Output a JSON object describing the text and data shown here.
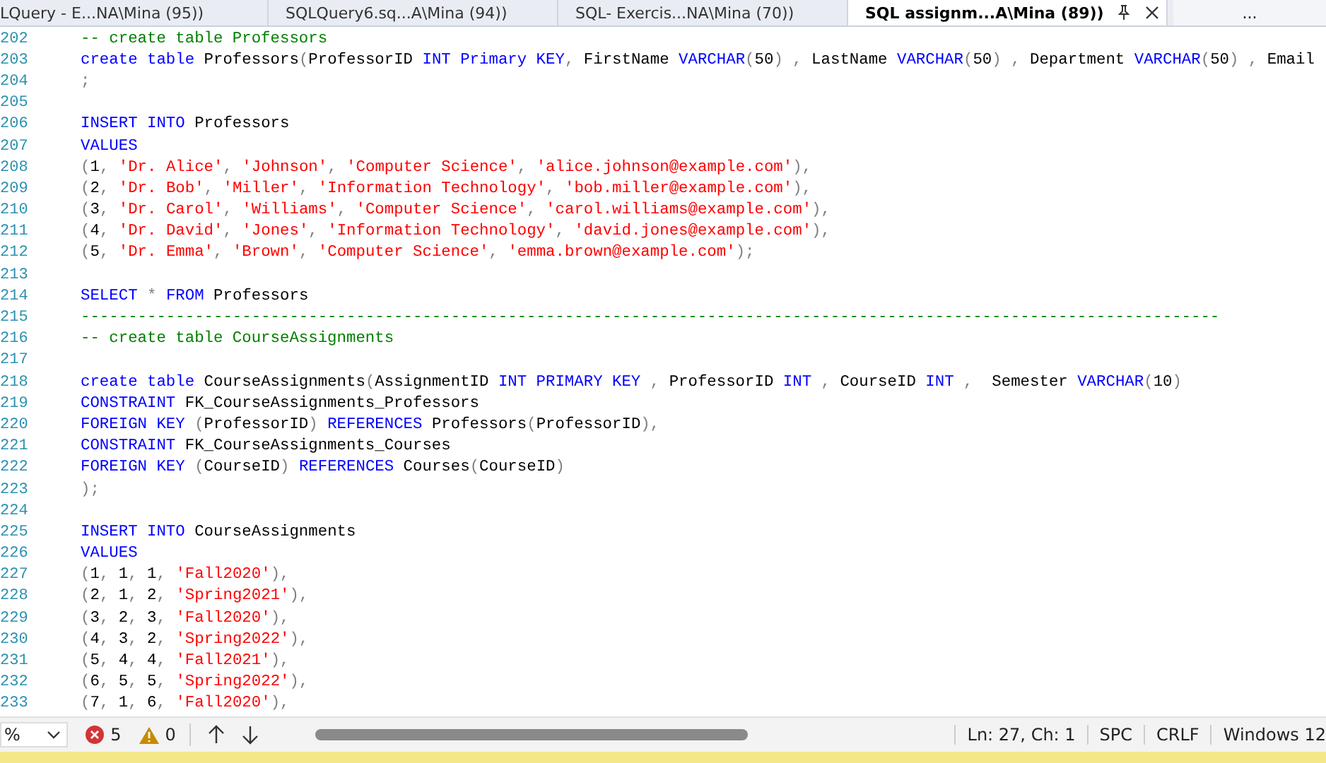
{
  "tabs": [
    {
      "label": "LQuery - E...NA\\Mina (95))",
      "selected": false
    },
    {
      "label": "SQLQuery6.sq...A\\Mina (94))",
      "selected": false
    },
    {
      "label": "SQL- Exercis...NA\\Mina (70))",
      "selected": false
    },
    {
      "label": "SQL assignm...A\\Mina (89))",
      "selected": true
    }
  ],
  "overflow_button": "...",
  "editor": {
    "lines": [
      {
        "number": "202",
        "tokens": [
          {
            "kind": "cmt",
            "text": "-- create table Professors"
          }
        ]
      },
      {
        "number": "203",
        "tokens": [
          {
            "kind": "kw",
            "text": "create table"
          },
          {
            "kind": "txt",
            "text": " Professors"
          },
          {
            "kind": "op",
            "text": "("
          },
          {
            "kind": "txt",
            "text": "ProfessorID "
          },
          {
            "kind": "kw",
            "text": "INT Primary KEY"
          },
          {
            "kind": "op",
            "text": ","
          },
          {
            "kind": "txt",
            "text": " FirstName "
          },
          {
            "kind": "kw",
            "text": "VARCHAR"
          },
          {
            "kind": "op",
            "text": "("
          },
          {
            "kind": "txt",
            "text": "50"
          },
          {
            "kind": "op",
            "text": ") , "
          },
          {
            "kind": "txt",
            "text": "LastName "
          },
          {
            "kind": "kw",
            "text": "VARCHAR"
          },
          {
            "kind": "op",
            "text": "("
          },
          {
            "kind": "txt",
            "text": "50"
          },
          {
            "kind": "op",
            "text": ") , "
          },
          {
            "kind": "txt",
            "text": "Department "
          },
          {
            "kind": "kw",
            "text": "VARCHAR"
          },
          {
            "kind": "op",
            "text": "("
          },
          {
            "kind": "txt",
            "text": "50"
          },
          {
            "kind": "op",
            "text": ") , "
          },
          {
            "kind": "txt",
            "text": "Email"
          }
        ]
      },
      {
        "number": "204",
        "tokens": [
          {
            "kind": "op",
            "text": ";"
          }
        ]
      },
      {
        "number": "205"
      },
      {
        "number": "206",
        "tokens": [
          {
            "kind": "kw",
            "text": "INSERT INTO"
          },
          {
            "kind": "txt",
            "text": " Professors"
          }
        ]
      },
      {
        "number": "207",
        "tokens": [
          {
            "kind": "kw",
            "text": "VALUES"
          }
        ]
      },
      {
        "number": "208",
        "tokens": [
          {
            "kind": "op",
            "text": "("
          },
          {
            "kind": "txt",
            "text": "1"
          },
          {
            "kind": "op",
            "text": ", "
          },
          {
            "kind": "str",
            "text": "'Dr. Alice'"
          },
          {
            "kind": "op",
            "text": ", "
          },
          {
            "kind": "str",
            "text": "'Johnson'"
          },
          {
            "kind": "op",
            "text": ", "
          },
          {
            "kind": "str",
            "text": "'Computer Science'"
          },
          {
            "kind": "op",
            "text": ", "
          },
          {
            "kind": "str",
            "text": "'alice.johnson@example.com'"
          },
          {
            "kind": "op",
            "text": "),"
          }
        ]
      },
      {
        "number": "209",
        "tokens": [
          {
            "kind": "op",
            "text": "("
          },
          {
            "kind": "txt",
            "text": "2"
          },
          {
            "kind": "op",
            "text": ", "
          },
          {
            "kind": "str",
            "text": "'Dr. Bob'"
          },
          {
            "kind": "op",
            "text": ", "
          },
          {
            "kind": "str",
            "text": "'Miller'"
          },
          {
            "kind": "op",
            "text": ", "
          },
          {
            "kind": "str",
            "text": "'Information Technology'"
          },
          {
            "kind": "op",
            "text": ", "
          },
          {
            "kind": "str",
            "text": "'bob.miller@example.com'"
          },
          {
            "kind": "op",
            "text": "),"
          }
        ]
      },
      {
        "number": "210",
        "tokens": [
          {
            "kind": "op",
            "text": "("
          },
          {
            "kind": "txt",
            "text": "3"
          },
          {
            "kind": "op",
            "text": ", "
          },
          {
            "kind": "str",
            "text": "'Dr. Carol'"
          },
          {
            "kind": "op",
            "text": ", "
          },
          {
            "kind": "str",
            "text": "'Williams'"
          },
          {
            "kind": "op",
            "text": ", "
          },
          {
            "kind": "str",
            "text": "'Computer Science'"
          },
          {
            "kind": "op",
            "text": ", "
          },
          {
            "kind": "str",
            "text": "'carol.williams@example.com'"
          },
          {
            "kind": "op",
            "text": "),"
          }
        ]
      },
      {
        "number": "211",
        "tokens": [
          {
            "kind": "op",
            "text": "("
          },
          {
            "kind": "txt",
            "text": "4"
          },
          {
            "kind": "op",
            "text": ", "
          },
          {
            "kind": "str",
            "text": "'Dr. David'"
          },
          {
            "kind": "op",
            "text": ", "
          },
          {
            "kind": "str",
            "text": "'Jones'"
          },
          {
            "kind": "op",
            "text": ", "
          },
          {
            "kind": "str",
            "text": "'Information Technology'"
          },
          {
            "kind": "op",
            "text": ", "
          },
          {
            "kind": "str",
            "text": "'david.jones@example.com'"
          },
          {
            "kind": "op",
            "text": "),"
          }
        ]
      },
      {
        "number": "212",
        "tokens": [
          {
            "kind": "op",
            "text": "("
          },
          {
            "kind": "txt",
            "text": "5"
          },
          {
            "kind": "op",
            "text": ", "
          },
          {
            "kind": "str",
            "text": "'Dr. Emma'"
          },
          {
            "kind": "op",
            "text": ", "
          },
          {
            "kind": "str",
            "text": "'Brown'"
          },
          {
            "kind": "op",
            "text": ", "
          },
          {
            "kind": "str",
            "text": "'Computer Science'"
          },
          {
            "kind": "op",
            "text": ", "
          },
          {
            "kind": "str",
            "text": "'emma.brown@example.com'"
          },
          {
            "kind": "op",
            "text": ");"
          }
        ]
      },
      {
        "number": "213"
      },
      {
        "number": "214",
        "tokens": [
          {
            "kind": "kw",
            "text": "SELECT"
          },
          {
            "kind": "op",
            "text": " * "
          },
          {
            "kind": "kw",
            "text": "FROM"
          },
          {
            "kind": "txt",
            "text": " Professors"
          }
        ]
      },
      {
        "number": "215",
        "tokens": [
          {
            "kind": "cmt",
            "text": "------------------------------------------------------------------------------------------------------------------------"
          }
        ]
      },
      {
        "number": "216",
        "tokens": [
          {
            "kind": "cmt",
            "text": "-- create table CourseAssignments"
          }
        ]
      },
      {
        "number": "217"
      },
      {
        "number": "218",
        "tokens": [
          {
            "kind": "kw",
            "text": "create table"
          },
          {
            "kind": "txt",
            "text": " CourseAssignments"
          },
          {
            "kind": "op",
            "text": "("
          },
          {
            "kind": "txt",
            "text": "AssignmentID "
          },
          {
            "kind": "kw",
            "text": "INT PRIMARY KEY"
          },
          {
            "kind": "op",
            "text": " , "
          },
          {
            "kind": "txt",
            "text": "ProfessorID "
          },
          {
            "kind": "kw",
            "text": "INT"
          },
          {
            "kind": "op",
            "text": " , "
          },
          {
            "kind": "txt",
            "text": "CourseID "
          },
          {
            "kind": "kw",
            "text": "INT"
          },
          {
            "kind": "op",
            "text": " ,  "
          },
          {
            "kind": "txt",
            "text": "Semester "
          },
          {
            "kind": "kw",
            "text": "VARCHAR"
          },
          {
            "kind": "op",
            "text": "("
          },
          {
            "kind": "txt",
            "text": "10"
          },
          {
            "kind": "op",
            "text": ")"
          }
        ]
      },
      {
        "number": "219",
        "tokens": [
          {
            "kind": "kw",
            "text": "CONSTRAINT"
          },
          {
            "kind": "txt",
            "text": " FK_CourseAssignments_Professors"
          }
        ]
      },
      {
        "number": "220",
        "tokens": [
          {
            "kind": "kw",
            "text": "FOREIGN KEY"
          },
          {
            "kind": "op",
            "text": " ("
          },
          {
            "kind": "txt",
            "text": "ProfessorID"
          },
          {
            "kind": "op",
            "text": ") "
          },
          {
            "kind": "kw",
            "text": "REFERENCES"
          },
          {
            "kind": "txt",
            "text": " Professors"
          },
          {
            "kind": "op",
            "text": "("
          },
          {
            "kind": "txt",
            "text": "ProfessorID"
          },
          {
            "kind": "op",
            "text": "),"
          }
        ]
      },
      {
        "number": "221",
        "tokens": [
          {
            "kind": "kw",
            "text": "CONSTRAINT"
          },
          {
            "kind": "txt",
            "text": " FK_CourseAssignments_Courses"
          }
        ]
      },
      {
        "number": "222",
        "tokens": [
          {
            "kind": "kw",
            "text": "FOREIGN KEY"
          },
          {
            "kind": "op",
            "text": " ("
          },
          {
            "kind": "txt",
            "text": "CourseID"
          },
          {
            "kind": "op",
            "text": ") "
          },
          {
            "kind": "kw",
            "text": "REFERENCES"
          },
          {
            "kind": "txt",
            "text": " Courses"
          },
          {
            "kind": "op",
            "text": "("
          },
          {
            "kind": "txt",
            "text": "CourseID"
          },
          {
            "kind": "op",
            "text": ")"
          }
        ]
      },
      {
        "number": "223",
        "tokens": [
          {
            "kind": "op",
            "text": ");"
          }
        ]
      },
      {
        "number": "224"
      },
      {
        "number": "225",
        "tokens": [
          {
            "kind": "kw",
            "text": "INSERT INTO"
          },
          {
            "kind": "txt",
            "text": " CourseAssignments"
          }
        ]
      },
      {
        "number": "226",
        "tokens": [
          {
            "kind": "kw",
            "text": "VALUES"
          }
        ]
      },
      {
        "number": "227",
        "tokens": [
          {
            "kind": "op",
            "text": "("
          },
          {
            "kind": "txt",
            "text": "1"
          },
          {
            "kind": "op",
            "text": ", "
          },
          {
            "kind": "txt",
            "text": "1"
          },
          {
            "kind": "op",
            "text": ", "
          },
          {
            "kind": "txt",
            "text": "1"
          },
          {
            "kind": "op",
            "text": ", "
          },
          {
            "kind": "str",
            "text": "'Fall2020'"
          },
          {
            "kind": "op",
            "text": "),"
          }
        ]
      },
      {
        "number": "228",
        "tokens": [
          {
            "kind": "op",
            "text": "("
          },
          {
            "kind": "txt",
            "text": "2"
          },
          {
            "kind": "op",
            "text": ", "
          },
          {
            "kind": "txt",
            "text": "1"
          },
          {
            "kind": "op",
            "text": ", "
          },
          {
            "kind": "txt",
            "text": "2"
          },
          {
            "kind": "op",
            "text": ", "
          },
          {
            "kind": "str",
            "text": "'Spring2021'"
          },
          {
            "kind": "op",
            "text": "),"
          }
        ]
      },
      {
        "number": "229",
        "tokens": [
          {
            "kind": "op",
            "text": "("
          },
          {
            "kind": "txt",
            "text": "3"
          },
          {
            "kind": "op",
            "text": ", "
          },
          {
            "kind": "txt",
            "text": "2"
          },
          {
            "kind": "op",
            "text": ", "
          },
          {
            "kind": "txt",
            "text": "3"
          },
          {
            "kind": "op",
            "text": ", "
          },
          {
            "kind": "str",
            "text": "'Fall2020'"
          },
          {
            "kind": "op",
            "text": "),"
          }
        ]
      },
      {
        "number": "230",
        "tokens": [
          {
            "kind": "op",
            "text": "("
          },
          {
            "kind": "txt",
            "text": "4"
          },
          {
            "kind": "op",
            "text": ", "
          },
          {
            "kind": "txt",
            "text": "3"
          },
          {
            "kind": "op",
            "text": ", "
          },
          {
            "kind": "txt",
            "text": "2"
          },
          {
            "kind": "op",
            "text": ", "
          },
          {
            "kind": "str",
            "text": "'Spring2022'"
          },
          {
            "kind": "op",
            "text": "),"
          }
        ]
      },
      {
        "number": "231",
        "tokens": [
          {
            "kind": "op",
            "text": "("
          },
          {
            "kind": "txt",
            "text": "5"
          },
          {
            "kind": "op",
            "text": ", "
          },
          {
            "kind": "txt",
            "text": "4"
          },
          {
            "kind": "op",
            "text": ", "
          },
          {
            "kind": "txt",
            "text": "4"
          },
          {
            "kind": "op",
            "text": ", "
          },
          {
            "kind": "str",
            "text": "'Fall2021'"
          },
          {
            "kind": "op",
            "text": "),"
          }
        ]
      },
      {
        "number": "232",
        "tokens": [
          {
            "kind": "op",
            "text": "("
          },
          {
            "kind": "txt",
            "text": "6"
          },
          {
            "kind": "op",
            "text": ", "
          },
          {
            "kind": "txt",
            "text": "5"
          },
          {
            "kind": "op",
            "text": ", "
          },
          {
            "kind": "txt",
            "text": "5"
          },
          {
            "kind": "op",
            "text": ", "
          },
          {
            "kind": "str",
            "text": "'Spring2022'"
          },
          {
            "kind": "op",
            "text": "),"
          }
        ]
      },
      {
        "number": "233",
        "tokens": [
          {
            "kind": "op",
            "text": "("
          },
          {
            "kind": "txt",
            "text": "7"
          },
          {
            "kind": "op",
            "text": ", "
          },
          {
            "kind": "txt",
            "text": "1"
          },
          {
            "kind": "op",
            "text": ", "
          },
          {
            "kind": "txt",
            "text": "6"
          },
          {
            "kind": "op",
            "text": ", "
          },
          {
            "kind": "str",
            "text": "'Fall2020'"
          },
          {
            "kind": "op",
            "text": "),"
          }
        ]
      }
    ]
  },
  "bottom_bar": {
    "zoom": "%",
    "errors": "5",
    "warnings": "0",
    "position": "Ln: 27, Ch: 1",
    "indent": "SPC",
    "line_endings": "CRLF",
    "encoding": "Windows 12"
  }
}
